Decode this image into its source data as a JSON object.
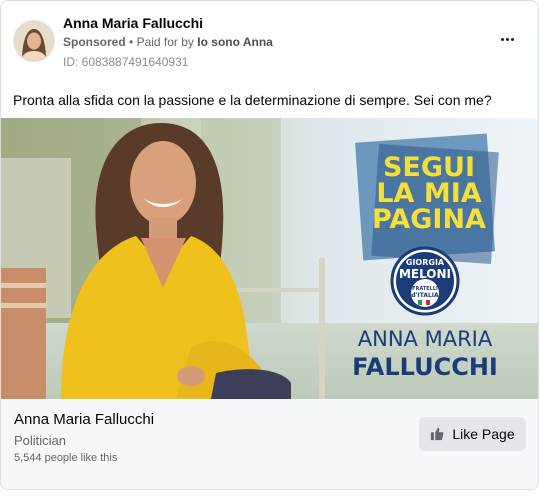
{
  "header": {
    "page_name": "Anna Maria Fallucchi",
    "sponsored": "Sponsored",
    "separator": "•",
    "paid_for_by": "Paid for by",
    "payer": "Io sono Anna",
    "ad_id": "ID: 6083887491640931"
  },
  "post": {
    "text": "Pronta alla sfida con la passione e la determinazione di sempre. Sei con me?"
  },
  "creative": {
    "headline_1": "SEGUI",
    "headline_2": "LA MIA",
    "headline_3": "PAGINA",
    "logo_top": "GIORGIA",
    "logo_mid": "MELONI",
    "logo_bottom_1": "FRATELLI",
    "logo_bottom_2": "d'ITALIA",
    "candidate_first": "ANNA MARIA",
    "candidate_last": "FALLUCCHI"
  },
  "footer": {
    "page_name": "Anna Maria Fallucchi",
    "category": "Politician",
    "likes": "5,544 people like this",
    "like_button": "Like Page"
  }
}
